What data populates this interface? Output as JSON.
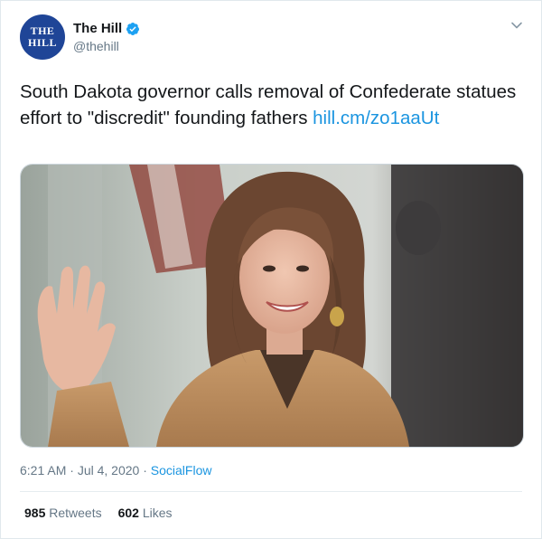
{
  "account": {
    "logo_text": "THE HILL",
    "display_name": "The Hill",
    "handle": "@thehill",
    "verified": true
  },
  "tweet": {
    "text": "South Dakota governor calls removal of Confederate statues effort to \"discredit\" founding fathers ",
    "link": "hill.cm/zo1aaUt"
  },
  "photo": {
    "description_icon": "photo-of-woman-waving"
  },
  "meta": {
    "time": "6:21 AM",
    "date": "Jul 4, 2020",
    "separator": "·",
    "source": "SocialFlow"
  },
  "stats": {
    "retweets_count": "985",
    "retweets_label": "Retweets",
    "likes_count": "602",
    "likes_label": "Likes"
  },
  "colors": {
    "link": "#1b95e0",
    "verified": "#1da1f2",
    "logo_bg": "#1f4597"
  }
}
